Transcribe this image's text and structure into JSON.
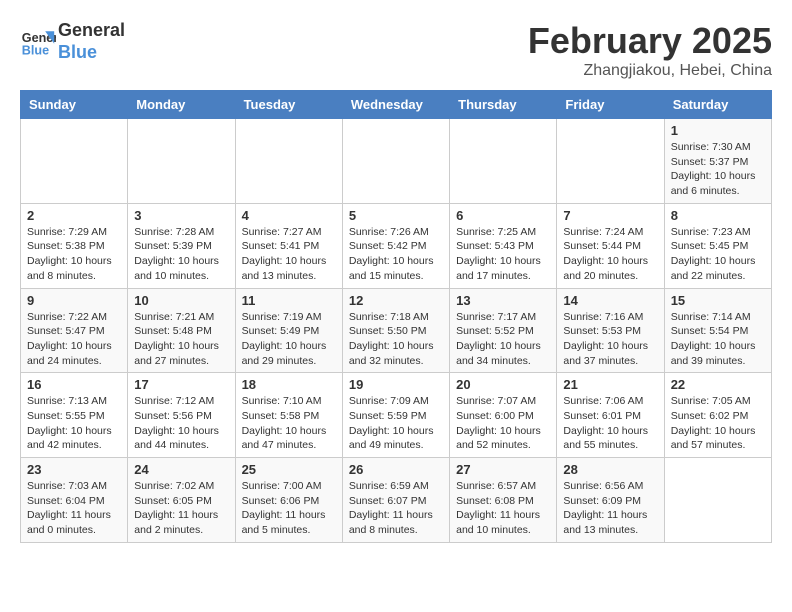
{
  "header": {
    "logo_line1": "General",
    "logo_line2": "Blue",
    "title": "February 2025",
    "location": "Zhangjiakou, Hebei, China"
  },
  "calendar": {
    "days_of_week": [
      "Sunday",
      "Monday",
      "Tuesday",
      "Wednesday",
      "Thursday",
      "Friday",
      "Saturday"
    ],
    "weeks": [
      [
        {
          "day": "",
          "info": ""
        },
        {
          "day": "",
          "info": ""
        },
        {
          "day": "",
          "info": ""
        },
        {
          "day": "",
          "info": ""
        },
        {
          "day": "",
          "info": ""
        },
        {
          "day": "",
          "info": ""
        },
        {
          "day": "1",
          "info": "Sunrise: 7:30 AM\nSunset: 5:37 PM\nDaylight: 10 hours and 6 minutes."
        }
      ],
      [
        {
          "day": "2",
          "info": "Sunrise: 7:29 AM\nSunset: 5:38 PM\nDaylight: 10 hours and 8 minutes."
        },
        {
          "day": "3",
          "info": "Sunrise: 7:28 AM\nSunset: 5:39 PM\nDaylight: 10 hours and 10 minutes."
        },
        {
          "day": "4",
          "info": "Sunrise: 7:27 AM\nSunset: 5:41 PM\nDaylight: 10 hours and 13 minutes."
        },
        {
          "day": "5",
          "info": "Sunrise: 7:26 AM\nSunset: 5:42 PM\nDaylight: 10 hours and 15 minutes."
        },
        {
          "day": "6",
          "info": "Sunrise: 7:25 AM\nSunset: 5:43 PM\nDaylight: 10 hours and 17 minutes."
        },
        {
          "day": "7",
          "info": "Sunrise: 7:24 AM\nSunset: 5:44 PM\nDaylight: 10 hours and 20 minutes."
        },
        {
          "day": "8",
          "info": "Sunrise: 7:23 AM\nSunset: 5:45 PM\nDaylight: 10 hours and 22 minutes."
        }
      ],
      [
        {
          "day": "9",
          "info": "Sunrise: 7:22 AM\nSunset: 5:47 PM\nDaylight: 10 hours and 24 minutes."
        },
        {
          "day": "10",
          "info": "Sunrise: 7:21 AM\nSunset: 5:48 PM\nDaylight: 10 hours and 27 minutes."
        },
        {
          "day": "11",
          "info": "Sunrise: 7:19 AM\nSunset: 5:49 PM\nDaylight: 10 hours and 29 minutes."
        },
        {
          "day": "12",
          "info": "Sunrise: 7:18 AM\nSunset: 5:50 PM\nDaylight: 10 hours and 32 minutes."
        },
        {
          "day": "13",
          "info": "Sunrise: 7:17 AM\nSunset: 5:52 PM\nDaylight: 10 hours and 34 minutes."
        },
        {
          "day": "14",
          "info": "Sunrise: 7:16 AM\nSunset: 5:53 PM\nDaylight: 10 hours and 37 minutes."
        },
        {
          "day": "15",
          "info": "Sunrise: 7:14 AM\nSunset: 5:54 PM\nDaylight: 10 hours and 39 minutes."
        }
      ],
      [
        {
          "day": "16",
          "info": "Sunrise: 7:13 AM\nSunset: 5:55 PM\nDaylight: 10 hours and 42 minutes."
        },
        {
          "day": "17",
          "info": "Sunrise: 7:12 AM\nSunset: 5:56 PM\nDaylight: 10 hours and 44 minutes."
        },
        {
          "day": "18",
          "info": "Sunrise: 7:10 AM\nSunset: 5:58 PM\nDaylight: 10 hours and 47 minutes."
        },
        {
          "day": "19",
          "info": "Sunrise: 7:09 AM\nSunset: 5:59 PM\nDaylight: 10 hours and 49 minutes."
        },
        {
          "day": "20",
          "info": "Sunrise: 7:07 AM\nSunset: 6:00 PM\nDaylight: 10 hours and 52 minutes."
        },
        {
          "day": "21",
          "info": "Sunrise: 7:06 AM\nSunset: 6:01 PM\nDaylight: 10 hours and 55 minutes."
        },
        {
          "day": "22",
          "info": "Sunrise: 7:05 AM\nSunset: 6:02 PM\nDaylight: 10 hours and 57 minutes."
        }
      ],
      [
        {
          "day": "23",
          "info": "Sunrise: 7:03 AM\nSunset: 6:04 PM\nDaylight: 11 hours and 0 minutes."
        },
        {
          "day": "24",
          "info": "Sunrise: 7:02 AM\nSunset: 6:05 PM\nDaylight: 11 hours and 2 minutes."
        },
        {
          "day": "25",
          "info": "Sunrise: 7:00 AM\nSunset: 6:06 PM\nDaylight: 11 hours and 5 minutes."
        },
        {
          "day": "26",
          "info": "Sunrise: 6:59 AM\nSunset: 6:07 PM\nDaylight: 11 hours and 8 minutes."
        },
        {
          "day": "27",
          "info": "Sunrise: 6:57 AM\nSunset: 6:08 PM\nDaylight: 11 hours and 10 minutes."
        },
        {
          "day": "28",
          "info": "Sunrise: 6:56 AM\nSunset: 6:09 PM\nDaylight: 11 hours and 13 minutes."
        },
        {
          "day": "",
          "info": ""
        }
      ]
    ]
  }
}
